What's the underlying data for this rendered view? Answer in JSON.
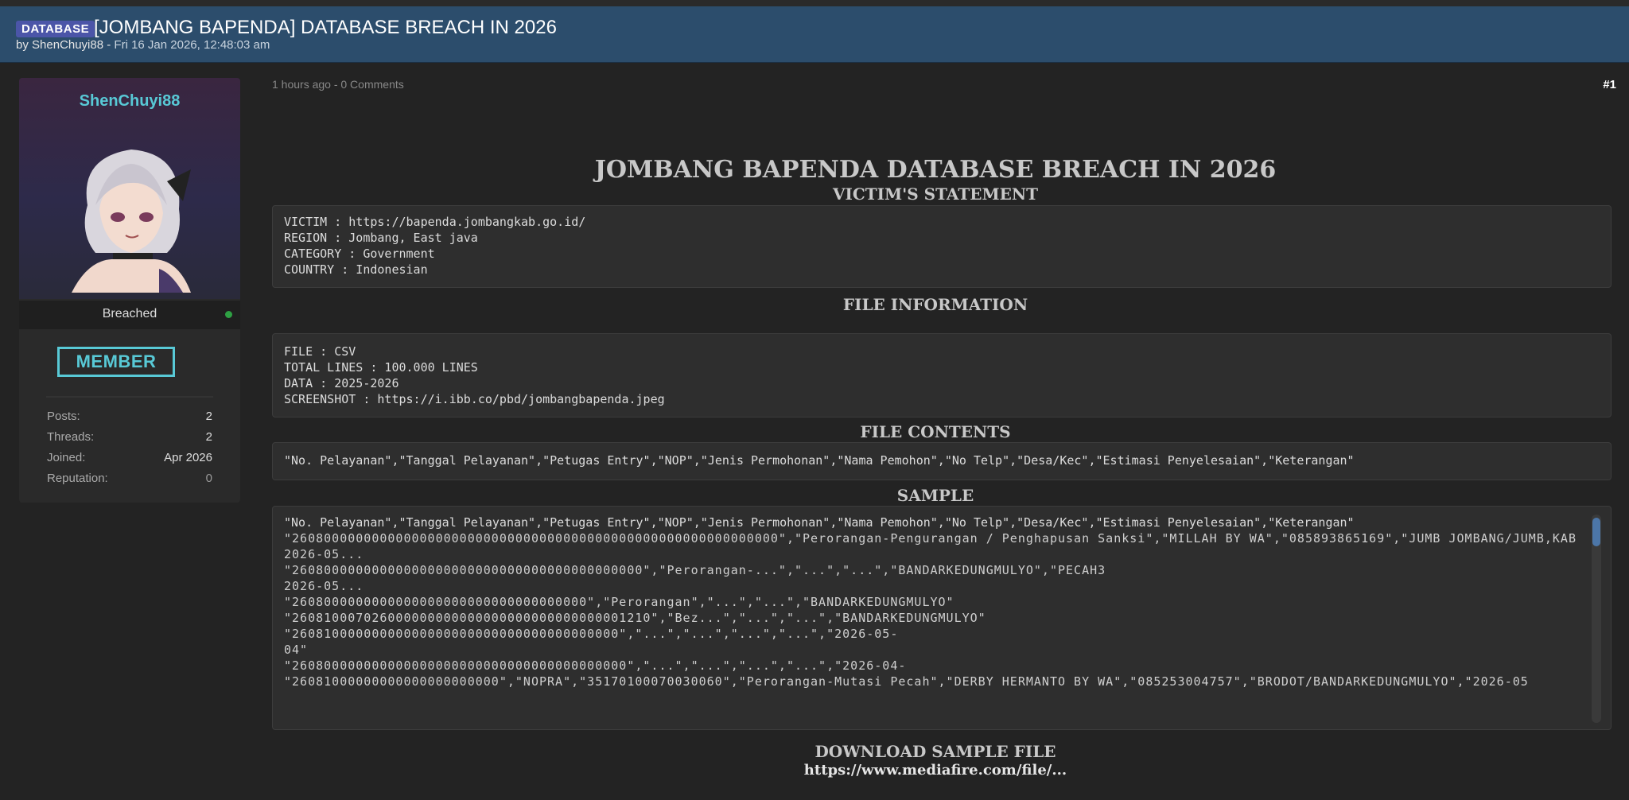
{
  "header": {
    "tag": "DATABASE",
    "title": "[JOMBANG BAPENDA] DATABASE BREACH IN 2026",
    "by_prefix": "by ShenChuyi88 - ",
    "by_date": "Fri 16 Jan 2026, 12:48:03 am"
  },
  "user": {
    "name": "ShenChuyi88",
    "status": "Breached",
    "rank": "MEMBER",
    "stats": [
      {
        "label": "Posts:",
        "value": "2"
      },
      {
        "label": "Threads:",
        "value": "2"
      },
      {
        "label": "Joined:",
        "value": "Apr 2026"
      },
      {
        "label": "Reputation:",
        "value": "0"
      }
    ]
  },
  "post": {
    "date": "1 hours ago - 0 Comments",
    "number": "#1",
    "main_title": "JOMBANG BAPENDA DATABASE BREACH IN 2026",
    "victim_heading": "VICTIM'S STATEMENT",
    "victim_lines": [
      "VICTIM : https://bapenda.jombangkab.go.id/",
      "REGION : Jombang, East java",
      "CATEGORY : Government",
      "COUNTRY : Indonesian"
    ],
    "file_info_heading": "FILE INFORMATION",
    "file_info_lines": [
      "FILE : CSV",
      "TOTAL LINES : 100.000 LINES",
      "DATA : 2025-2026",
      "SCREENSHOT : https://i.ibb.co/pbd/jombangbapenda.jpeg"
    ],
    "file_contents_heading": "FILE CONTENTS",
    "file_contents_line": "\"No. Pelayanan\",\"Tanggal Pelayanan\",\"Petugas Entry\",\"NOP\",\"Jenis Permohonan\",\"Nama Pemohon\",\"No Telp\",\"Desa/Kec\",\"Estimasi Penyelesaian\",\"Keterangan\"",
    "sample_heading": "SAMPLE",
    "sample_lines": [
      "\"No. Pelayanan\",\"Tanggal Pelayanan\",\"Petugas Entry\",\"NOP\",\"Jenis Permohonan\",\"Nama Pemohon\",\"No Telp\",\"Desa/Kec\",\"Estimasi Penyelesaian\",\"Keterangan\"",
      "\"2608000000000000000000000000000000000000000000000000000000000\",\"Perorangan-Pengurangan / Penghapusan Sanksi\",\"MILLAH BY WA\",\"085893865169\",\"JUMB JOMBANG/JUMB,KAB",
      "2026-05...",
      "\"26080000000000000000000000000000000000000000\",\"Perorangan-...\",\"...\",\"...\",\"BANDARKEDUNGMULYO\",\"PECAH3",
      "2026-05...",
      "\"2608000000000000000000000000000000000\",\"Perorangan\",\"...\",\"...\",\"BANDARKEDUNGMULYO\"",
      "\"260810007026000000000000000000000000000001210\",\"Bez...\",\"...\",\"...\",\"BANDARKEDUNGMULYO\"",
      "\"26081000000000000000000000000000000000000\",\"...\",\"...\",\"...\",\"...\",\"2026-05-",
      "04\"",
      "\"260800000000000000000000000000000000000000\",\"...\",\"...\",\"...\",\"...\",\"2026-04-",
      "\"26081000000000000000000000\",\"NOPRA\",\"35170100070030060\",\"Perorangan-Mutasi Pecah\",\"DERBY HERMANTO BY WA\",\"085253004757\",\"BRODOT/BANDARKEDUNGMULYO\",\"2026-05"
    ],
    "download_heading": "DOWNLOAD SAMPLE FILE",
    "download_link": "https://www.mediafire.com/file/..."
  },
  "colors": {
    "header_bg": "#2c4d6c",
    "tag_bg": "#4b55a8",
    "accent": "#58c9d6",
    "page_bg": "#232323",
    "online": "#2ea043"
  }
}
